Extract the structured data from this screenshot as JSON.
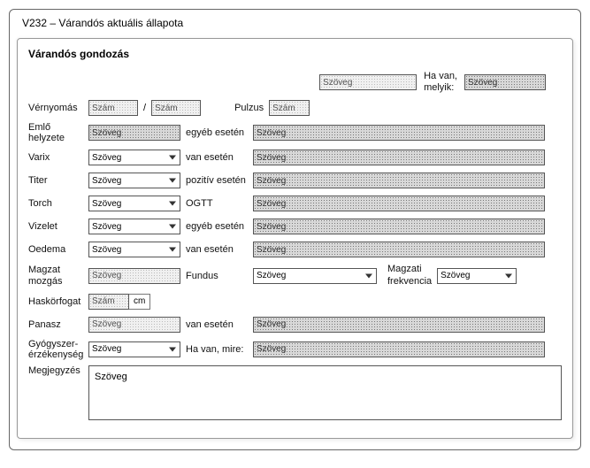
{
  "window": {
    "title": "V232 – Várandós aktuális állapota"
  },
  "panel": {
    "title": "Várandós gondozás"
  },
  "placeholders": {
    "text": "Szöveg",
    "number": "Szám"
  },
  "labels": {
    "havan": "Ha van,\nmelyik:",
    "vernyomas": "Vérnyomás",
    "pulzus": "Pulzus",
    "emlo": "Emlő helyzete",
    "egyeb_eseten": "egyéb esetén",
    "varix": "Varix",
    "van_eseten": "van esetén",
    "titer": "Titer",
    "pozitiv_eseten": "pozitív esetén",
    "torch": "Torch",
    "ogtt": "OGTT",
    "vizelet": "Vizelet",
    "oedema": "Oedema",
    "magzat_mozgas": "Magzat\nmozgás",
    "fundus": "Fundus",
    "magzati_frekvencia": "Magzati\nfrekvencia",
    "haskorfogat": "Haskörfogat",
    "cm": "cm",
    "panasz": "Panasz",
    "gyogyszer": "Gyógyszer-\nérzékenység",
    "havan_mire": "Ha van, mire:",
    "megjegyzes": "Megjegyzés"
  }
}
